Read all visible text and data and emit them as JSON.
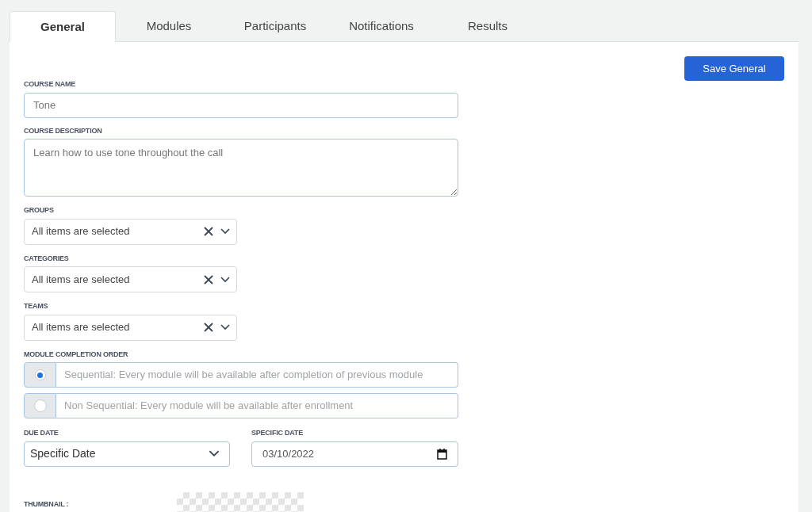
{
  "tabs": [
    {
      "label": "General",
      "selected": true
    },
    {
      "label": "Modules",
      "selected": false
    },
    {
      "label": "Participants",
      "selected": false
    },
    {
      "label": "Notifications",
      "selected": false
    },
    {
      "label": "Results",
      "selected": false
    }
  ],
  "save_button": "Save General",
  "course_name": {
    "label": "COURSE NAME",
    "value": "Tone"
  },
  "course_description": {
    "label": "COURSE DESCRIPTION",
    "value": "Learn how to use tone throughout the call"
  },
  "multi_selects": [
    {
      "label": "GROUPS",
      "value": "All items are selected"
    },
    {
      "label": "CATEGORIES",
      "value": "All items are selected"
    },
    {
      "label": "TEAMS",
      "value": "All items are selected"
    }
  ],
  "module_completion_order": {
    "label": "MODULE COMPLETION ORDER",
    "options": [
      {
        "label": "Sequential: Every module will be available after completion of previous module",
        "selected": true
      },
      {
        "label": "Non Sequential: Every module will be available after enrollment",
        "selected": false
      }
    ]
  },
  "due_date": {
    "label": "DUE DATE",
    "value": "Specific Date"
  },
  "specific_date": {
    "label": "SPECIFIC DATE",
    "value": "03/10/2022"
  },
  "thumbnail": {
    "label": "THUMBNAIL :"
  }
}
